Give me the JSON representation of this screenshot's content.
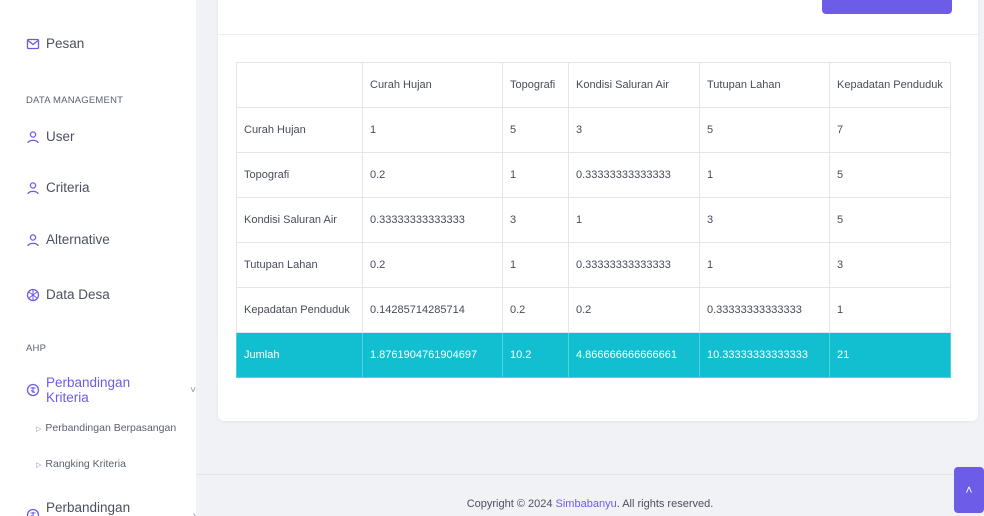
{
  "sidebar": {
    "pesan": "Pesan",
    "section_data": "DATA MANAGEMENT",
    "user": "User",
    "criteria": "Criteria",
    "alternative": "Alternative",
    "data_desa": "Data Desa",
    "section_ahp": "AHP",
    "perbandingan_kriteria": "Perbandingan Kriteria",
    "chev_down": "˅",
    "sub_perbandingan_berpasangan": "Perbandingan Berpasangan",
    "sub_rangking_kriteria": "Rangking Kriteria",
    "perbandingan_alternatif": "Perbandingan Alternatif",
    "chev_right": "›"
  },
  "table": {
    "headers": [
      "",
      "Curah Hujan",
      "Topografi",
      "Kondisi Saluran Air",
      "Tutupan Lahan",
      "Kepadatan Penduduk"
    ],
    "rows": [
      [
        "Curah Hujan",
        "1",
        "5",
        "3",
        "5",
        "7"
      ],
      [
        "Topografi",
        "0.2",
        "1",
        "0.33333333333333",
        "1",
        "5"
      ],
      [
        "Kondisi Saluran Air",
        "0.33333333333333",
        "3",
        "1",
        "3",
        "5"
      ],
      [
        "Tutupan Lahan",
        "0.2",
        "1",
        "0.33333333333333",
        "1",
        "3"
      ],
      [
        "Kepadatan Penduduk",
        "0.14285714285714",
        "0.2",
        "0.2",
        "0.33333333333333",
        "1"
      ]
    ],
    "total": [
      "Jumlah",
      "1.8761904761904697",
      "10.2",
      "4.866666666666661",
      "10.33333333333333",
      "21"
    ]
  },
  "footer": {
    "prefix": "Copyright © 2024 ",
    "brand": "Simbabanyu",
    "suffix": ". All rights reserved."
  },
  "scroll_top": "˄",
  "colors": {
    "accent": "#6c5ce7",
    "total_row": "#12bfd1"
  }
}
